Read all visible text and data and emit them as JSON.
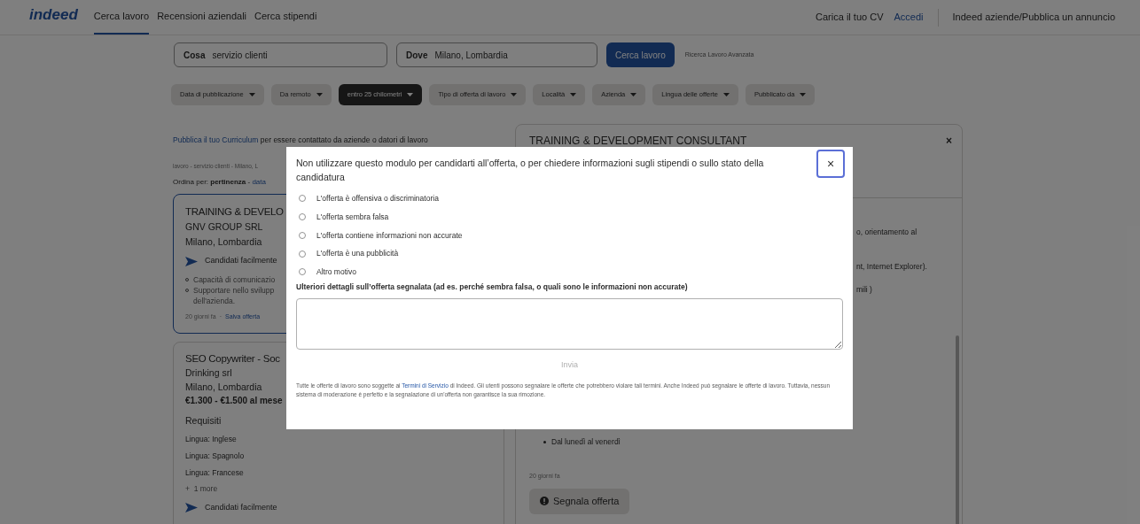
{
  "header": {
    "logo": "indeed",
    "nav": [
      {
        "label": "Cerca lavoro",
        "selected": true
      },
      {
        "label": "Recensioni aziendali",
        "selected": false
      },
      {
        "label": "Cerca stipendi",
        "selected": false
      }
    ],
    "upload_cv": "Carica il tuo CV",
    "login": "Accedi",
    "employers": "Indeed aziende/Pubblica un annuncio"
  },
  "search": {
    "what_label": "Cosa",
    "what_value": "servizio clienti",
    "where_label": "Dove",
    "where_value": "Milano, Lombardia",
    "button": "Cerca lavoro",
    "advanced_link": "Ricerca Lavoro Avanzata"
  },
  "filters": [
    {
      "label": "Data di pubblicazione",
      "selected": false
    },
    {
      "label": "Da remoto",
      "selected": false
    },
    {
      "label": "entro 25 chilometri",
      "selected": true
    },
    {
      "label": "Tipo di offerta di lavoro",
      "selected": false
    },
    {
      "label": "Località",
      "selected": false
    },
    {
      "label": "Azienda",
      "selected": false
    },
    {
      "label": "Lingua delle offerte",
      "selected": false
    },
    {
      "label": "Pubblicato da",
      "selected": false
    }
  ],
  "results": {
    "cv_link": "Pubblica il tuo Curriculum",
    "cv_text": "per essere contattato da aziende o datori di lavoro",
    "breadcrumb": "lavoro - servizio clienti - Milano, L",
    "sort": "Ordina per: **pertinenza** - ",
    "sort_link": "data",
    "jobs": [
      {
        "title": "TRAINING & DEVELO",
        "company": "GNV GROUP SRL",
        "location": "Milano, Lombardia",
        "easy_apply": "Candidati facilmente",
        "bullets": [
          "Capacità di comunicazio",
          "Supportare nello svilupp\ndell'azienda."
        ],
        "age": "20 giorni fa",
        "separator": "·",
        "save": "Salva offerta",
        "selected": true
      },
      {
        "title": "SEO Copywriter - Soc",
        "company": "Drinking srl",
        "location": "Milano, Lombardia",
        "salary": "€1.300 - €1.500 al mese",
        "requirements_title": "Requisiti",
        "requirements": [
          "Lingua: Inglese",
          "Lingua: Spagnolo",
          "Lingua: Francese"
        ],
        "more": "+  1 more",
        "easy_apply": "Candidati facilmente",
        "selected": false
      }
    ]
  },
  "detail": {
    "title": "TRAINING & DEVELOPMENT CONSULTANT",
    "close": "×",
    "fragments": [
      "o, orientamento al",
      "nt, Internet Explorer).",
      "mili )"
    ],
    "bullets": [
      "Dal lunedì al venerdì"
    ],
    "age": "20 giorni fa",
    "report_button": "Segnala offerta"
  },
  "modal": {
    "title": "Non utilizzare questo modulo per candidarti all’offerta, o per chiedere informazioni sugli stipendi o sullo stato della candidatura",
    "close": "×",
    "reasons": [
      {
        "label": "L'offerta è offensiva o discriminatoria",
        "selected": false
      },
      {
        "label": "L'offerta sembra falsa",
        "selected": false
      },
      {
        "label": "L'offerta contiene informazioni non accurate",
        "selected": false
      },
      {
        "label": "L'offerta è una pubblicità",
        "selected": false
      },
      {
        "label": "Altro motivo",
        "selected": false
      }
    ],
    "details_label": "Ulteriori dettagli sull’offerta segnalata (ad es. perché sembra falsa, o quali sono le informazioni non accurate)",
    "submit": {
      "label": "Invia",
      "disabled": true
    },
    "disclaimer_before": "Tutte le offerte di lavoro sono soggette ai",
    "disclaimer_link": "Termini di Servizio",
    "disclaimer_after": "di Indeed. Gli utenti possono segnalare le offerte che potrebbero violare tali termini. Anche Indeed può segnalare le offerte di lavoro. Tuttavia, nessun sistema di moderazione è perfetto e la segnalazione di un'offerta non garantisce la sua rimozione."
  }
}
